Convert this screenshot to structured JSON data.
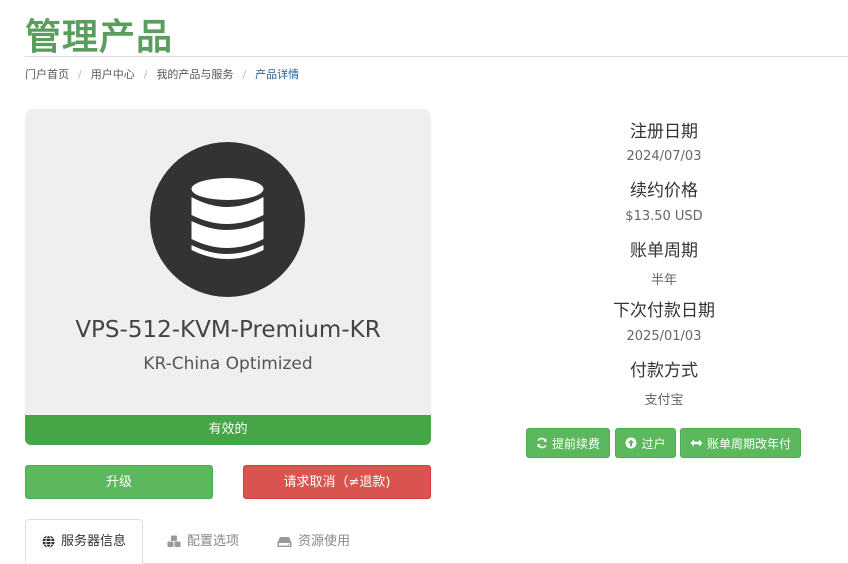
{
  "page": {
    "title": "管理产品"
  },
  "breadcrumb": [
    "门户首页",
    "用户中心",
    "我的产品与服务",
    "产品详情"
  ],
  "product": {
    "name": "VPS-512-KVM-Premium-KR",
    "group": "KR-China Optimized",
    "status": "有效的",
    "icon": "database-icon"
  },
  "buttons": {
    "upgrade": "升级",
    "cancel": "请求取消（≠退款)"
  },
  "details": [
    {
      "label": "注册日期",
      "value": "2024/07/03"
    },
    {
      "label": "续约价格",
      "value": "$13.50 USD"
    },
    {
      "label": "账单周期",
      "value": "半年"
    },
    {
      "label": "下次付款日期",
      "value": "2025/01/03"
    },
    {
      "label": "付款方式",
      "value": "支付宝"
    }
  ],
  "actions": [
    {
      "label": "提前续费",
      "icon": "refresh-icon"
    },
    {
      "label": "过户",
      "icon": "arrow-up-circle-icon"
    },
    {
      "label": "账单周期改年付",
      "icon": "arrows-horizontal-icon"
    }
  ],
  "tabs": [
    {
      "label": "服务器信息",
      "icon": "globe-icon",
      "active": true
    },
    {
      "label": "配置选项",
      "icon": "cubes-icon",
      "active": false
    },
    {
      "label": "资源使用",
      "icon": "hdd-icon",
      "active": false
    }
  ],
  "colors": {
    "title": "#5a9e5e",
    "status": "#46a546",
    "success": "#5cb85c",
    "danger": "#d9534f",
    "card": "#efefef"
  }
}
